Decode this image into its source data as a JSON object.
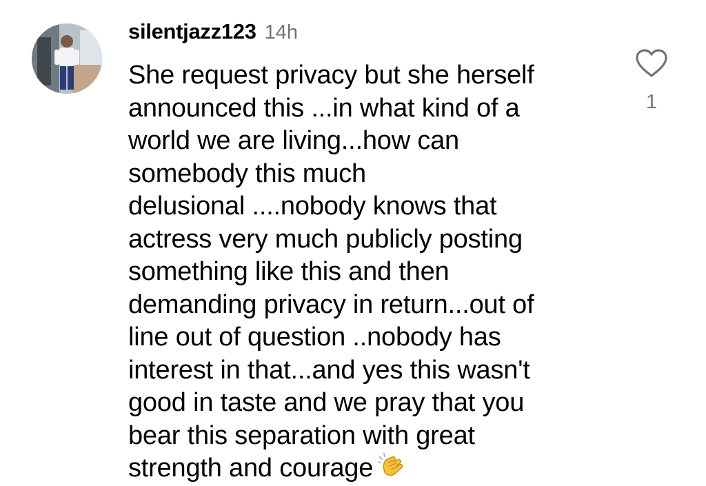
{
  "comment": {
    "username": "silentjazz123",
    "timestamp": "14h",
    "text_lines": [
      "She request privacy but she herself",
      "announced this ...in what kind of a",
      "world we are living...how can",
      "somebody this much",
      "delusional ....nobody knows that",
      "actress very much publicly posting",
      "something like this and then",
      "demanding privacy in return...out of",
      "line out of question ..nobody has",
      "interest in that...and yes this wasn't",
      "good in taste and we pray that you",
      "bear this separation with great",
      "strength and courage"
    ],
    "trailing_emoji": "clapping-hands-icon",
    "like_count": "1"
  },
  "icons": {
    "like": "heart-outline-icon",
    "avatar": "avatar"
  },
  "colors": {
    "text": "#000000",
    "secondary_text": "#737373",
    "background": "#ffffff",
    "emoji": "#f5c33b"
  }
}
